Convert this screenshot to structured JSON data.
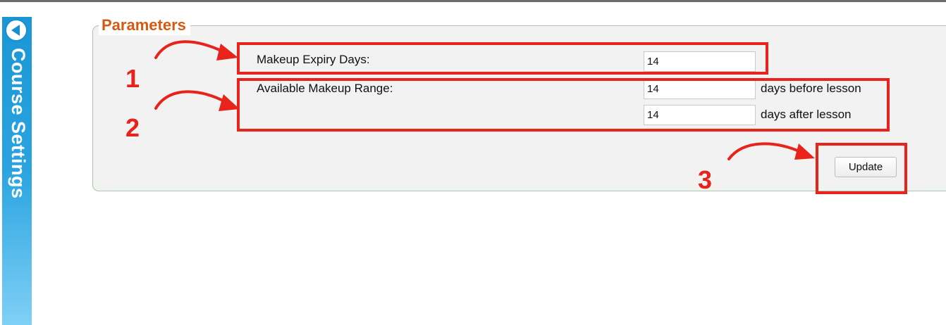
{
  "sidebar": {
    "tab_label": "Course Settings",
    "toggle_icon": "chevron-left-icon",
    "color": "#1a96d6"
  },
  "parameters": {
    "legend": "Parameters",
    "makeup_expiry": {
      "label": "Makeup Expiry Days:",
      "value": "14"
    },
    "makeup_range": {
      "label": "Available Makeup Range:",
      "before_value": "14",
      "before_suffix": "days before lesson",
      "after_value": "14",
      "after_suffix": "days after lesson"
    },
    "update_label": "Update"
  },
  "annotations": {
    "color": "#e8231c",
    "steps": [
      "1",
      "2",
      "3"
    ]
  }
}
